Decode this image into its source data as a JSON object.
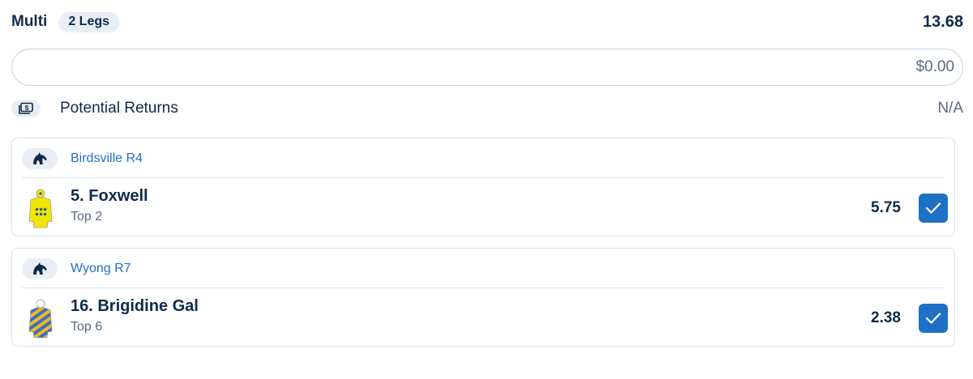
{
  "header": {
    "title": "Multi",
    "legs_badge": "2 Legs",
    "total_odds": "13.68"
  },
  "stake": {
    "value": "$0.00"
  },
  "returns": {
    "label": "Potential Returns",
    "value": "N/A",
    "icon": "money-icon"
  },
  "legs": [
    {
      "race": "Birdsville R4",
      "runner": "5. Foxwell",
      "market": "Top 2",
      "odds": "5.75",
      "selected": true,
      "silks_colors": [
        "#f2e600",
        "#1d4f8a"
      ]
    },
    {
      "race": "Wyong R7",
      "runner": "16. Brigidine Gal",
      "market": "Top 6",
      "odds": "2.38",
      "selected": true,
      "silks_colors": [
        "#3a6ec7",
        "#f2b81a"
      ]
    }
  ],
  "colors": {
    "accent": "#1f6fc5",
    "text": "#0f2a4a",
    "muted": "#5a6b80"
  }
}
